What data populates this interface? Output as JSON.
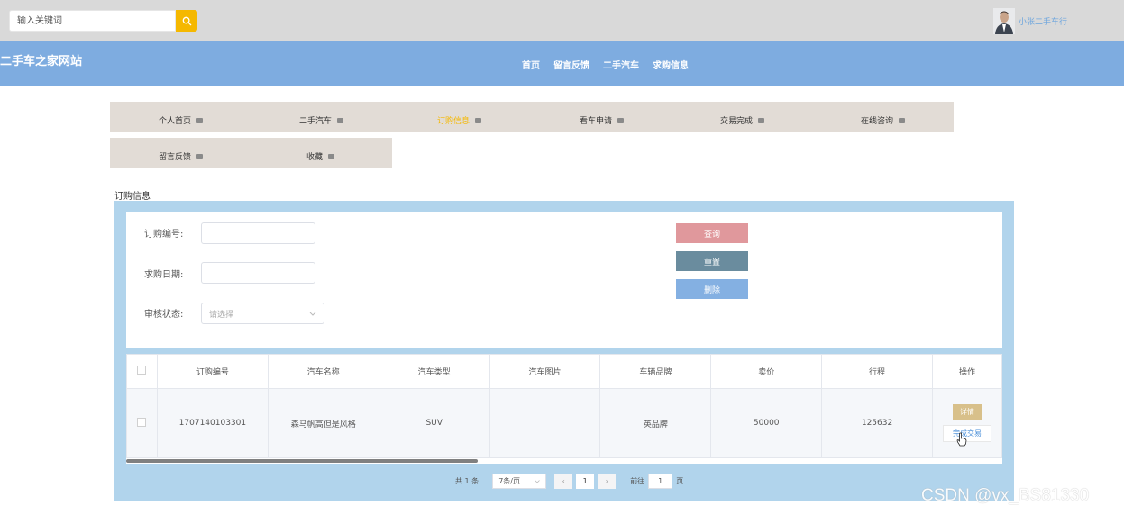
{
  "header": {
    "search_placeholder": "输入关键词",
    "username": "小张二手车行"
  },
  "navbar": {
    "site_title": "二手车之家网站",
    "items": [
      "首页",
      "留言反馈",
      "二手汽车",
      "求购信息"
    ]
  },
  "tabs": {
    "row1": [
      "个人首页",
      "二手汽车",
      "订购信息",
      "看车申请",
      "交易完成",
      "在线咨询"
    ],
    "row2": [
      "留言反馈",
      "收藏"
    ],
    "active": "订购信息"
  },
  "section_title": "订购信息",
  "filters": {
    "order_no_label": "订购编号:",
    "date_label": "求购日期:",
    "status_label": "审核状态:",
    "status_placeholder": "请选择"
  },
  "buttons": {
    "query": "查询",
    "reset": "重置",
    "delete": "删除"
  },
  "colors": {
    "query": "#e0989c",
    "reset": "#6a8c9e",
    "delete": "#84b0e2"
  },
  "table": {
    "headers": [
      "订购编号",
      "汽车名称",
      "汽车类型",
      "汽车图片",
      "车辆品牌",
      "卖价",
      "行程",
      "操作"
    ],
    "rows": [
      [
        "1707140103301",
        "森马帆高但是风格",
        "SUV",
        "",
        "英品牌",
        "50000",
        "125632"
      ]
    ],
    "actions": {
      "detail": "详情",
      "complete": "完成交易"
    }
  },
  "pagination": {
    "total": "共 1 条",
    "page_size": "7条/页",
    "current_page": "1",
    "goto_label": "前往",
    "goto_value": "1",
    "page_suffix": "页"
  },
  "watermark": "CSDN @vx_BS81330"
}
